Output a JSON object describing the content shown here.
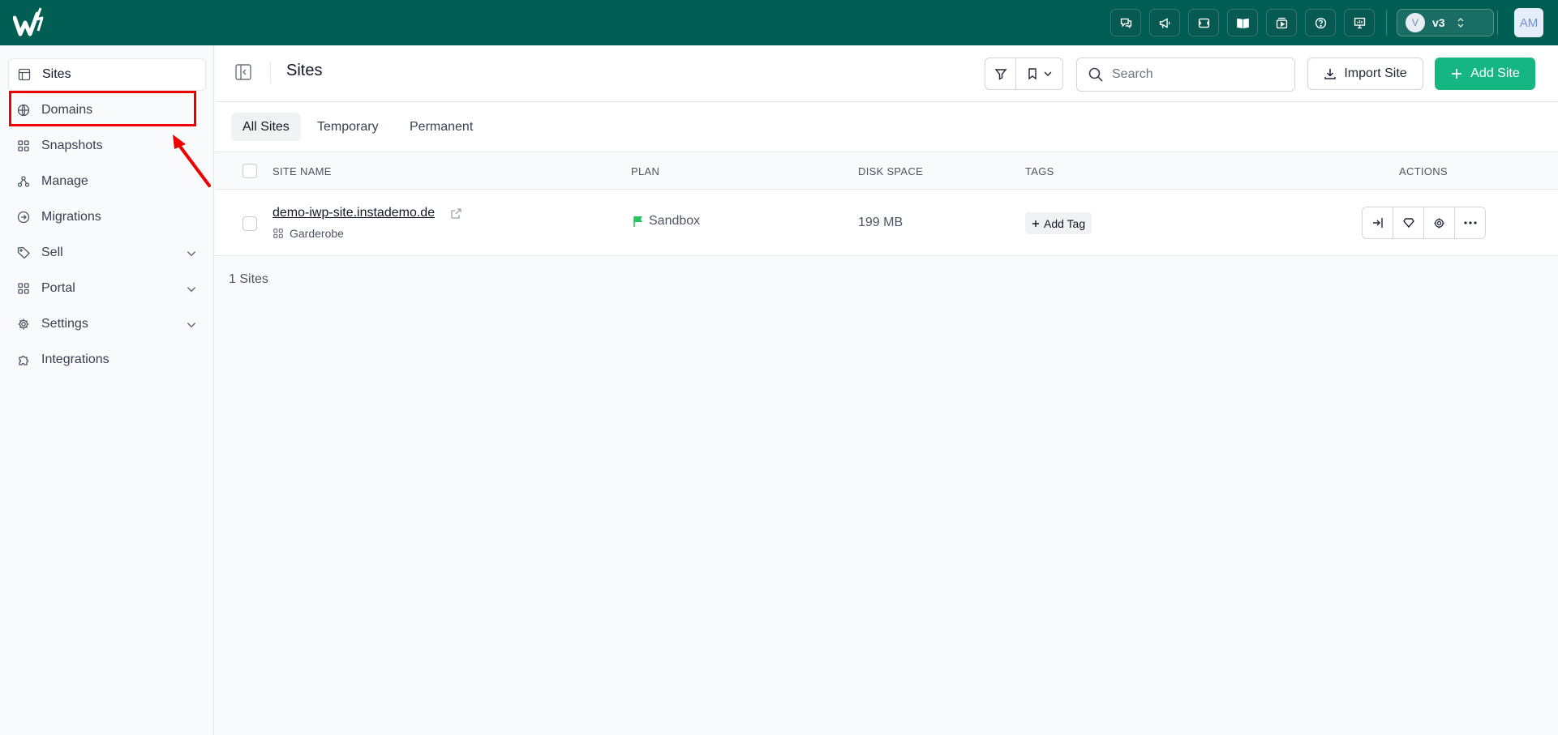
{
  "topbar": {
    "icons": [
      "chat-icon",
      "megaphone-icon",
      "ticket-icon",
      "book-icon",
      "video-icon",
      "help-icon",
      "presentation-icon"
    ],
    "version_initial": "V",
    "version_label": "v3",
    "avatar_initials": "AM",
    "background": "#005e54"
  },
  "sidebar": {
    "items": [
      {
        "label": "Sites",
        "icon": "layout-icon",
        "active": true
      },
      {
        "label": "Domains",
        "icon": "globe-icon"
      },
      {
        "label": "Snapshots",
        "icon": "grid-icon"
      },
      {
        "label": "Manage",
        "icon": "tree-icon"
      },
      {
        "label": "Migrations",
        "icon": "arrow-circle-icon"
      },
      {
        "label": "Sell",
        "icon": "tag-icon",
        "expandable": true
      },
      {
        "label": "Portal",
        "icon": "grid-icon",
        "expandable": true
      },
      {
        "label": "Settings",
        "icon": "gear-icon",
        "expandable": true
      },
      {
        "label": "Integrations",
        "icon": "puzzle-icon"
      }
    ],
    "highlighted_item": "Domains",
    "highlight_color": "#ee0000"
  },
  "header": {
    "title": "Sites",
    "search_placeholder": "Search",
    "import_label": "Import Site",
    "add_label": "Add Site",
    "accent": "#16b683"
  },
  "tabs": [
    "All Sites",
    "Temporary",
    "Permanent"
  ],
  "table": {
    "columns": [
      "SITE NAME",
      "PLAN",
      "DISK SPACE",
      "TAGS",
      "ACTIONS"
    ],
    "rows": [
      {
        "site_name": "demo-iwp-site.instademo.de",
        "group": "Garderobe",
        "plan": "Sandbox",
        "disk_space": "199 MB",
        "tag_action": "Add Tag",
        "plan_color": "#22c55e"
      }
    ]
  },
  "footer_count": "1 Sites"
}
